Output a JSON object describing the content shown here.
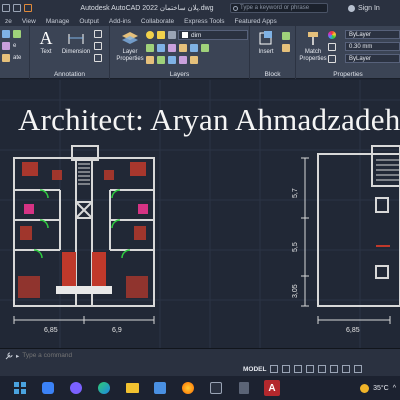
{
  "titlebar": {
    "app_title": "Autodesk AutoCAD 2022  پلان ساختمان.dwg",
    "search_placeholder": "Type a keyword or phrase",
    "signin_label": "Sign In"
  },
  "ribbon_tabs": [
    "ze",
    "View",
    "Manage",
    "Output",
    "Add-ins",
    "Collaborate",
    "Express Tools",
    "Featured Apps"
  ],
  "ribbon": {
    "text_label": "Text",
    "dimension_label": "Dimension",
    "annotation_title": "Annotation",
    "layer_properties_label": "Layer Properties",
    "layer_name": "dim",
    "layers_title": "Layers",
    "insert_label": "Insert",
    "block_title": "Block",
    "match_properties_label": "Match Properties",
    "bylayer_color": "ByLayer",
    "lineweight": "0.30 mm",
    "bylayer_linetype": "ByLayer",
    "properties_title": "Properties",
    "left_labels": [
      "e",
      "ate"
    ]
  },
  "drawing": {
    "watermark": "Architect: Aryan Ahmadzadeh",
    "dims_left": [
      "6,85",
      "6,9"
    ],
    "dims_right_vertical": [
      "5,7",
      "5,5",
      "3,05"
    ],
    "dim_right_bottom": "6,85"
  },
  "command": {
    "placeholder": "Type a command"
  },
  "status": {
    "model_label": "MODEL"
  },
  "tray": {
    "temperature": "35°C"
  },
  "colors": {
    "canvas": "#212836",
    "ribbon": "#3b4455",
    "wall": "#d8d8d8",
    "furniture": "#c0392b",
    "accent_magenta": "#d63384",
    "accent_green": "#2ecc40"
  }
}
